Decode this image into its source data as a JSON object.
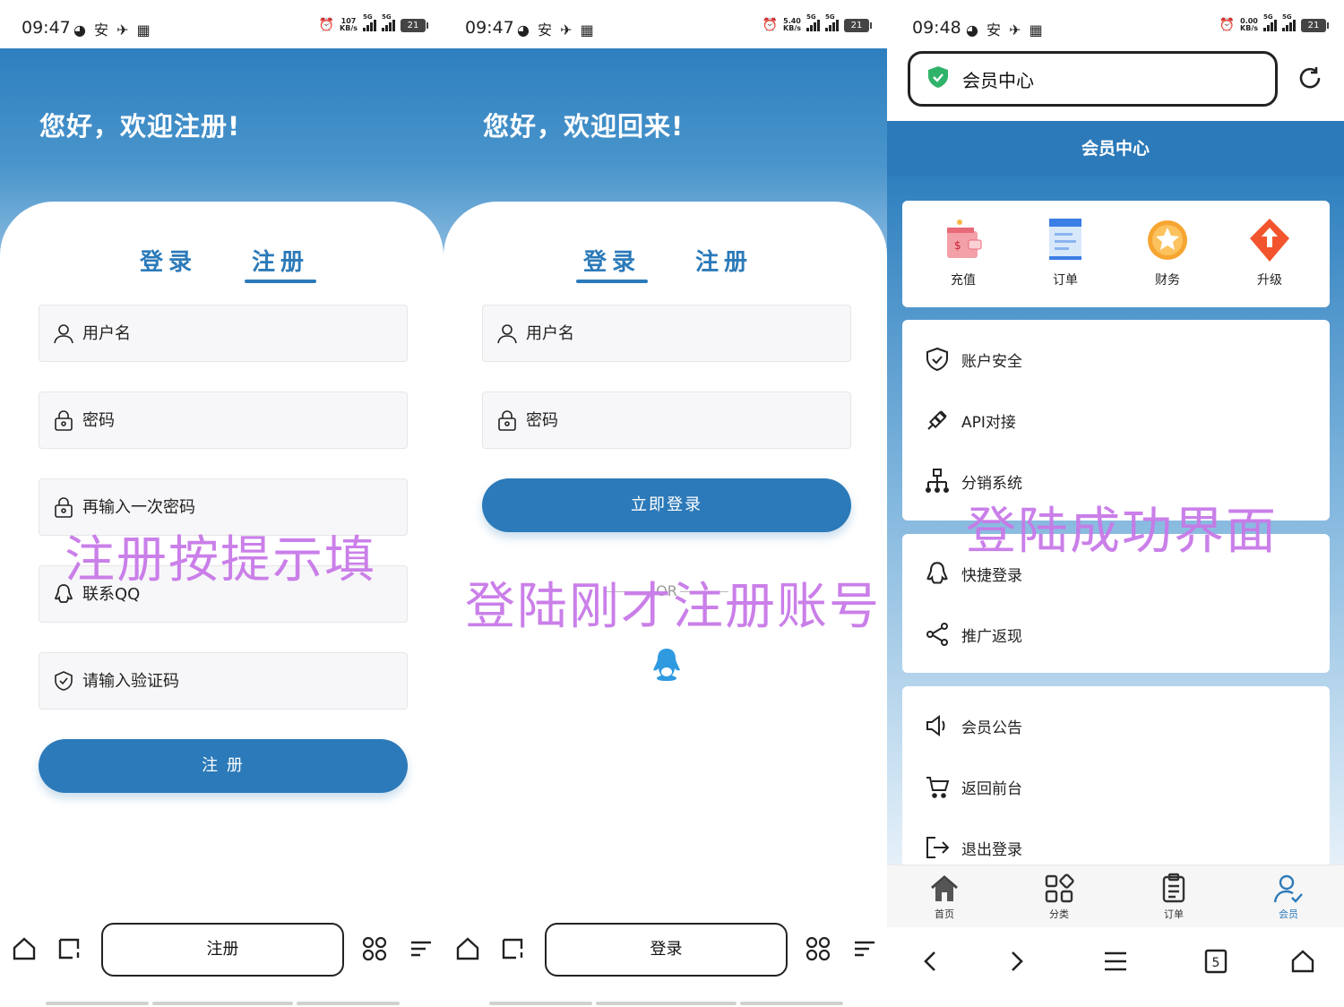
{
  "status": [
    {
      "time": "09:47",
      "notif": "◕ 安 ✈ ▦",
      "speed_top": "107",
      "speed_unit": "KB/s",
      "net1": "5G",
      "net2": "5G",
      "battery": "21"
    },
    {
      "time": "09:47",
      "notif": "◕ 安 ✈ ▦",
      "speed_top": "5.40",
      "speed_unit": "KB/s",
      "net1": "5G",
      "net2": "5G",
      "battery": "21"
    },
    {
      "time": "09:48",
      "notif": "◕ 安 ✈ ▦",
      "speed_top": "0.00",
      "speed_unit": "KB/s",
      "net1": "5G",
      "net2": "5G",
      "battery": "21"
    }
  ],
  "register": {
    "title": "您好，欢迎注册!",
    "tab_login": "登录",
    "tab_register": "注册",
    "username_placeholder": "用户名",
    "password_placeholder": "密码",
    "password2_placeholder": "再输入一次密码",
    "qq_placeholder": "联系QQ",
    "captcha_placeholder": "请输入验证码",
    "submit": "注 册",
    "watermark": "注册按提示填",
    "url": "注册"
  },
  "login": {
    "title": "您好，欢迎回来!",
    "tab_login": "登录",
    "tab_register": "注册",
    "username_placeholder": "用户名",
    "password_placeholder": "密码",
    "submit": "立即登录",
    "or": "OR",
    "watermark": "登陆刚才注册账号",
    "url": "登录"
  },
  "member": {
    "address": "会员中心",
    "header": "会员中心",
    "quick": [
      "充值",
      "订单",
      "财务",
      "升级"
    ],
    "group1": [
      "账户安全",
      "API对接",
      "分销系统"
    ],
    "group2": [
      "快捷登录",
      "推广返现"
    ],
    "group3": [
      "会员公告",
      "返回前台",
      "退出登录"
    ],
    "watermark": "登陆成功界面",
    "nav": [
      "首页",
      "分类",
      "订单",
      "会员"
    ],
    "tab_count": "5",
    "colors": {
      "primary": "#2c7ab9",
      "watermark": "#c879e8"
    }
  }
}
